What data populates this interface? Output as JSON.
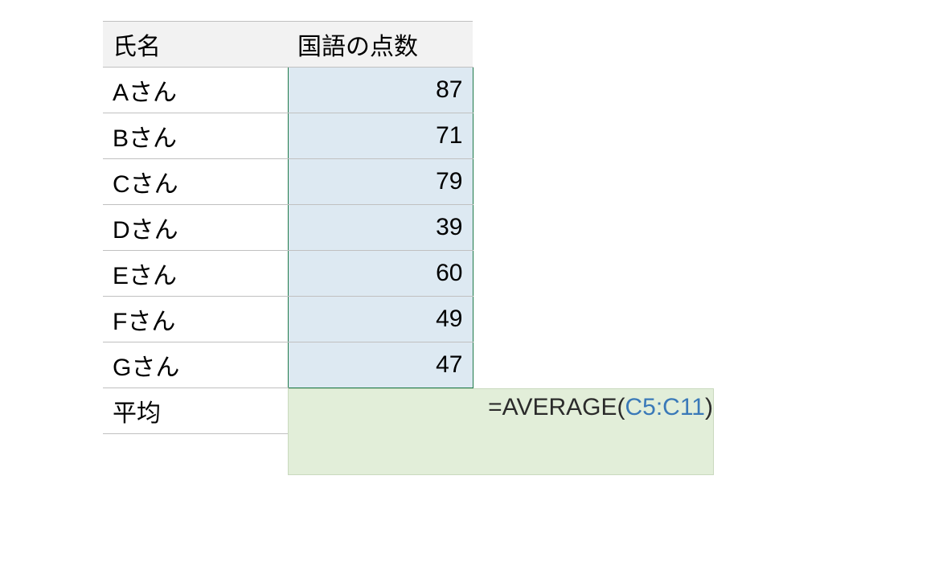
{
  "table": {
    "headers": {
      "name": "氏名",
      "score": "国語の点数"
    },
    "rows": [
      {
        "name": "Aさん",
        "score": "87"
      },
      {
        "name": "Bさん",
        "score": "71"
      },
      {
        "name": "Cさん",
        "score": "79"
      },
      {
        "name": "Dさん",
        "score": "39"
      },
      {
        "name": "Eさん",
        "score": "60"
      },
      {
        "name": "Fさん",
        "score": "49"
      },
      {
        "name": "Gさん",
        "score": "47"
      }
    ],
    "avg_label": "平均"
  },
  "formula": {
    "prefix": "=AVERAGE(",
    "range": "C5:C11",
    "suffix": ")"
  }
}
